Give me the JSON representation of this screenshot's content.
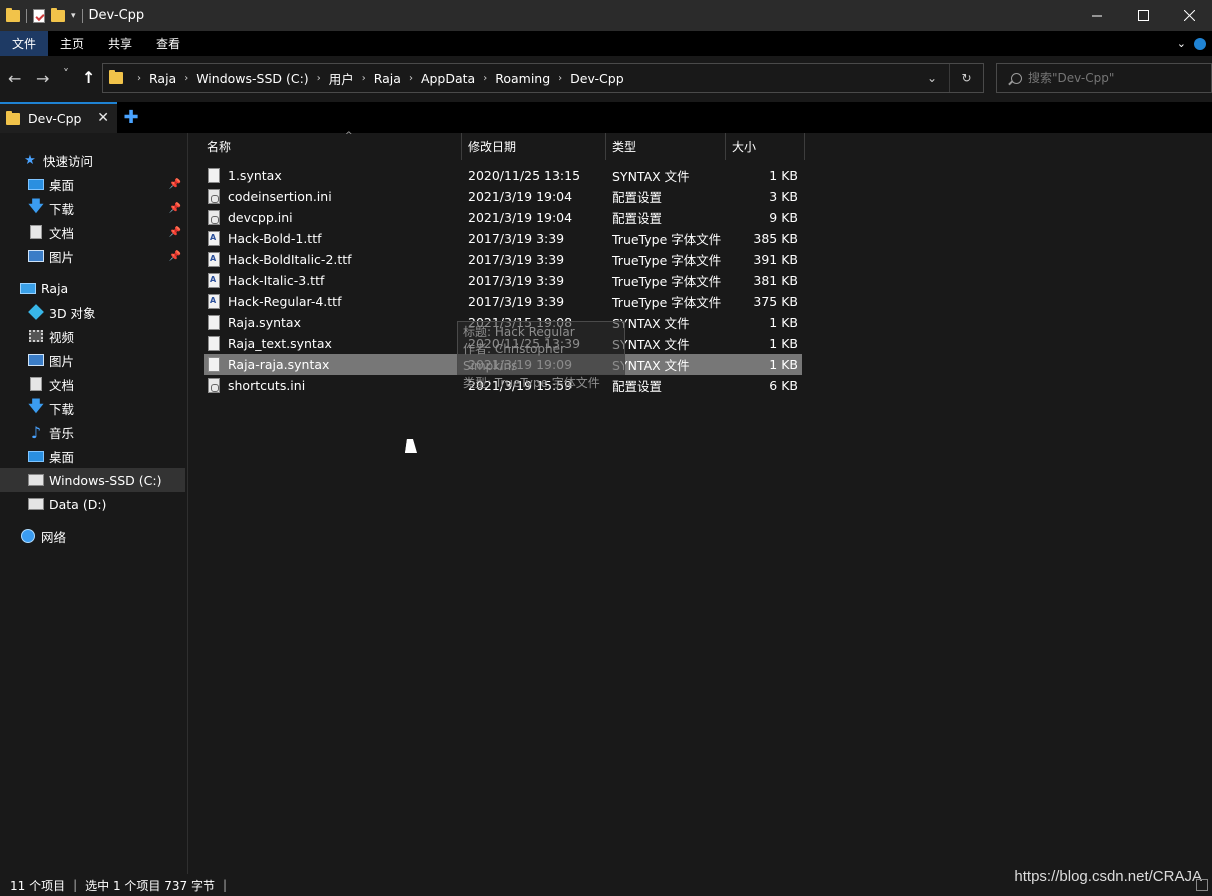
{
  "window": {
    "title": "Dev-Cpp"
  },
  "ribbon": {
    "tabs": [
      "文件",
      "主页",
      "共享",
      "查看"
    ]
  },
  "nav": {
    "back": "←",
    "forward": "→",
    "recent": "˅",
    "up": "↑"
  },
  "address": {
    "crumbs": [
      "Raja",
      "Windows-SSD (C:)",
      "用户",
      "Raja",
      "AppData",
      "Roaming",
      "Dev-Cpp"
    ]
  },
  "search": {
    "placeholder": "搜索\"Dev-Cpp\""
  },
  "tab": {
    "label": "Dev-Cpp"
  },
  "sidebar": {
    "items": [
      {
        "label": "快速访问",
        "icon": "star-icon"
      },
      {
        "label": "桌面",
        "icon": "desktop-icon",
        "pinned": true
      },
      {
        "label": "下载",
        "icon": "download-icon",
        "pinned": true
      },
      {
        "label": "文档",
        "icon": "document-icon",
        "pinned": true
      },
      {
        "label": "图片",
        "icon": "pictures-icon",
        "pinned": true
      },
      {
        "label": "Raja",
        "icon": "computer-icon"
      },
      {
        "label": "3D 对象",
        "icon": "3d-objects-icon"
      },
      {
        "label": "视频",
        "icon": "video-icon"
      },
      {
        "label": "图片",
        "icon": "pictures-icon"
      },
      {
        "label": "文档",
        "icon": "document-icon"
      },
      {
        "label": "下载",
        "icon": "download-icon"
      },
      {
        "label": "音乐",
        "icon": "music-icon"
      },
      {
        "label": "桌面",
        "icon": "desktop-icon"
      },
      {
        "label": "Windows-SSD (C:)",
        "icon": "drive-icon",
        "selected": true
      },
      {
        "label": "Data (D:)",
        "icon": "drive-icon"
      },
      {
        "label": "网络",
        "icon": "network-icon"
      }
    ]
  },
  "columns": {
    "name": "名称",
    "date": "修改日期",
    "type": "类型",
    "size": "大小"
  },
  "files": [
    {
      "name": "1.syntax",
      "date": "2020/11/25 13:15",
      "type": "SYNTAX 文件",
      "size": "1 KB",
      "kind": "file"
    },
    {
      "name": "codeinsertion.ini",
      "date": "2021/3/19 19:04",
      "type": "配置设置",
      "size": "3 KB",
      "kind": "ini"
    },
    {
      "name": "devcpp.ini",
      "date": "2021/3/19 19:04",
      "type": "配置设置",
      "size": "9 KB",
      "kind": "ini"
    },
    {
      "name": "Hack-Bold-1.ttf",
      "date": "2017/3/19 3:39",
      "type": "TrueType 字体文件",
      "size": "385 KB",
      "kind": "ttf"
    },
    {
      "name": "Hack-BoldItalic-2.ttf",
      "date": "2017/3/19 3:39",
      "type": "TrueType 字体文件",
      "size": "391 KB",
      "kind": "ttf"
    },
    {
      "name": "Hack-Italic-3.ttf",
      "date": "2017/3/19 3:39",
      "type": "TrueType 字体文件",
      "size": "381 KB",
      "kind": "ttf"
    },
    {
      "name": "Hack-Regular-4.ttf",
      "date": "2017/3/19 3:39",
      "type": "TrueType 字体文件",
      "size": "375 KB",
      "kind": "ttf"
    },
    {
      "name": "Raja.syntax",
      "date": "2021/3/15 19:08",
      "type": "SYNTAX 文件",
      "size": "1 KB",
      "kind": "file"
    },
    {
      "name": "Raja_text.syntax",
      "date": "2020/11/25 13:39",
      "type": "SYNTAX 文件",
      "size": "1 KB",
      "kind": "file"
    },
    {
      "name": "Raja-raja.syntax",
      "date": "2021/3/19 19:09",
      "type": "SYNTAX 文件",
      "size": "1 KB",
      "kind": "file",
      "selected": true
    },
    {
      "name": "shortcuts.ini",
      "date": "2021/3/19 15:59",
      "type": "配置设置",
      "size": "6 KB",
      "kind": "ini"
    }
  ],
  "tooltip": {
    "line1": "标题: Hack Regular",
    "line2": "作者: Christopher Simpkins",
    "line3": "类型: TrueType 字体文件"
  },
  "status": {
    "count": "11 个项目",
    "selection": "选中 1 个项目  737 字节"
  },
  "watermark": "https://blog.csdn.net/CRAJA"
}
